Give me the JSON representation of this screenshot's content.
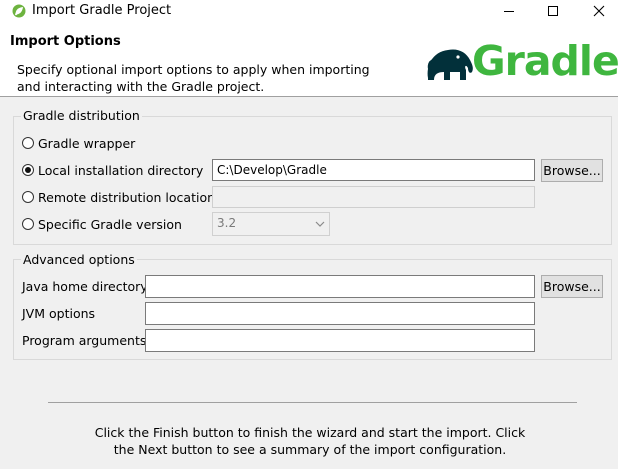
{
  "window": {
    "title": "Import Gradle Project",
    "icon": "spring-leaf-icon",
    "controls": {
      "minimize": "minimize-icon",
      "maximize": "maximize-icon",
      "close": "close-icon"
    }
  },
  "header": {
    "title": "Import Options",
    "description": "Specify optional import options to apply when importing and interacting with the Gradle project.",
    "logo_text": "Gradle",
    "logo_icon": "gradle-elephant-icon",
    "logo_color": "#3fb63f",
    "elephant_color": "#02303a"
  },
  "distribution": {
    "label": "Gradle distribution",
    "options": {
      "wrapper": {
        "label": "Gradle wrapper",
        "selected": false
      },
      "local": {
        "label": "Local installation directory",
        "selected": true,
        "value": "C:\\Develop\\Gradle"
      },
      "remote": {
        "label": "Remote distribution location",
        "selected": false,
        "value": ""
      },
      "version": {
        "label": "Specific Gradle version",
        "selected": false,
        "value": "3.2"
      }
    },
    "browse_label": "Browse..."
  },
  "advanced": {
    "label": "Advanced options",
    "java_home": {
      "label": "Java home directory",
      "value": ""
    },
    "jvm_options": {
      "label": "JVM options",
      "value": ""
    },
    "program_arguments": {
      "label": "Program arguments",
      "value": ""
    },
    "browse_label": "Browse..."
  },
  "footer": {
    "text": "Click the Finish button to finish the wizard and start the import. Click the Next button to see a summary of the import configuration."
  }
}
